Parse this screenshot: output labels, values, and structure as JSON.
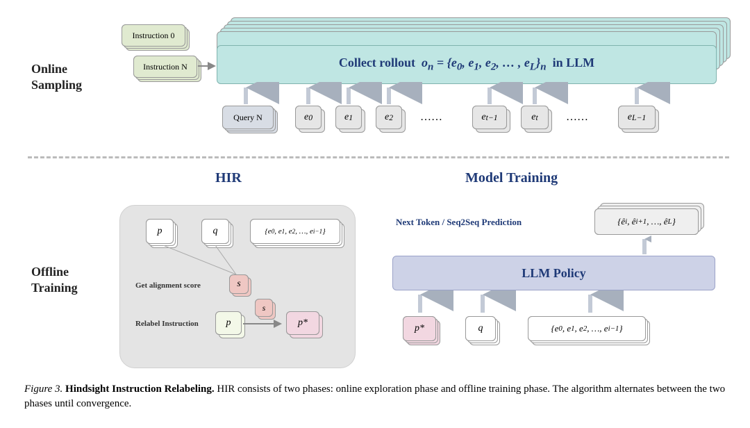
{
  "labels": {
    "online_sampling": "Online\nSampling",
    "offline_training": "Offline\nTraining"
  },
  "headings": {
    "hir": "HIR",
    "model_training": "Model Training"
  },
  "online": {
    "instruction0": "Instruction 0",
    "instructionN": "Instruction N",
    "rollout_prefix": "Collect rollout",
    "rollout_mid": "o",
    "rollout_sub": "n",
    "rollout_tail": "in LLM",
    "set_items": [
      "e₀",
      "e₁",
      "e₂",
      "…",
      "e_L"
    ],
    "queryN": "Query N",
    "tokens": [
      "e₀",
      "e₁",
      "e₂",
      "……",
      "e_{t−1}",
      "e_t",
      "……",
      "e_{L−1}"
    ]
  },
  "hir_panel": {
    "p": "p",
    "q": "q",
    "seq": "{e₀, e₁, e₂, …, e_{i−1}}",
    "get_align": "Get alignment score",
    "s": "s",
    "relabel": "Relabel Instruction",
    "p2": "p",
    "pstar": "p*"
  },
  "model_training": {
    "next_token": "Next Token / Seq2Seq Prediction",
    "output_seq": "{ê_i, ê_{i+1}, …, ê_L}",
    "llm_policy": "LLM Policy",
    "pstar": "p*",
    "q": "q",
    "input_seq": "{e₀, e₁, e₂, …, e_{i−1}}"
  },
  "caption": {
    "fig": "Figure 3.",
    "bold": "Hindsight Instruction Relabeling.",
    "rest": " HIR consists of two phases: online exploration phase and offline training phase. The algorithm alternates between the two phases until convergence."
  }
}
